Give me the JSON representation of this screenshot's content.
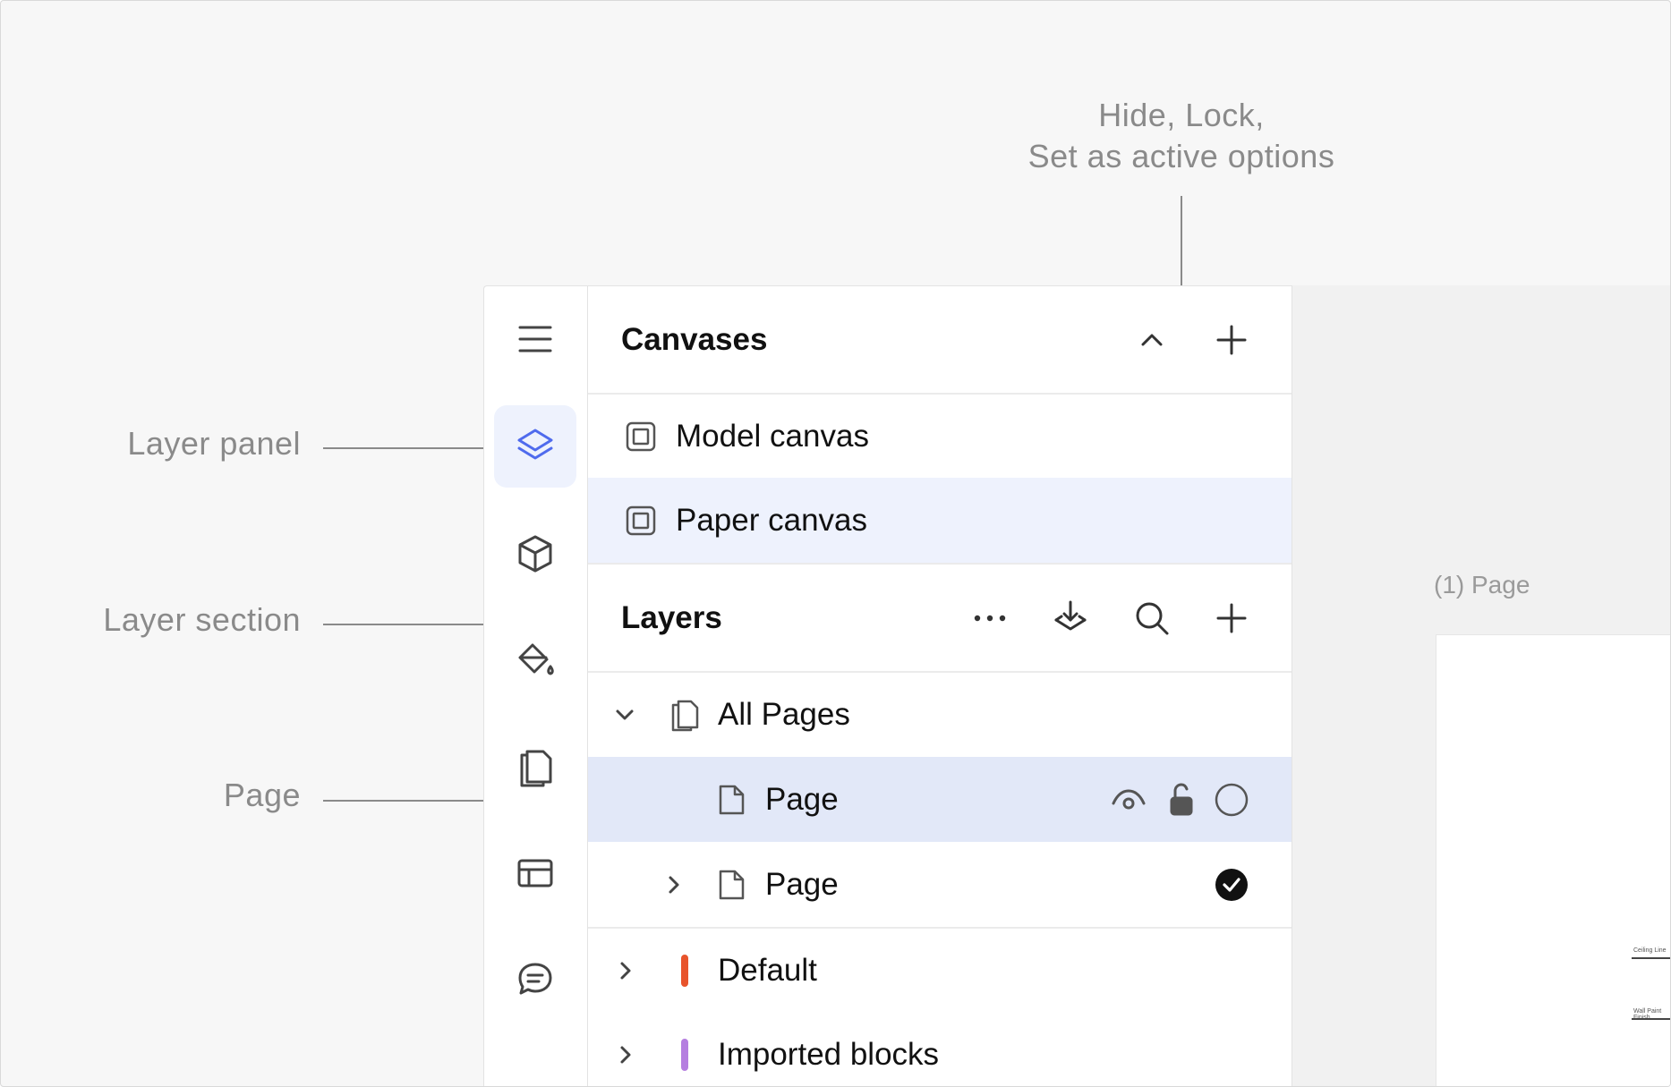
{
  "annotations": {
    "hide_lock": "Hide, Lock,",
    "set_active": "Set as active options",
    "layer_panel": "Layer panel",
    "layer_section": "Layer section",
    "page": "Page"
  },
  "rail": {
    "items": [
      {
        "icon": "menu-icon",
        "active": false
      },
      {
        "icon": "layers-icon",
        "active": true
      },
      {
        "icon": "cube-icon",
        "active": false
      },
      {
        "icon": "paint-bucket-icon",
        "active": false
      },
      {
        "icon": "pages-icon",
        "active": false
      },
      {
        "icon": "table-icon",
        "active": false
      },
      {
        "icon": "comment-icon",
        "active": false
      }
    ]
  },
  "canvases": {
    "title": "Canvases",
    "items": [
      {
        "label": "Model canvas",
        "selected": false
      },
      {
        "label": "Paper canvas",
        "selected": true
      }
    ]
  },
  "layers": {
    "title": "Layers",
    "tree": {
      "all_pages": "All Pages",
      "pages": [
        {
          "label": "Page",
          "selected": true,
          "expandable": false
        },
        {
          "label": "Page",
          "selected": false,
          "expandable": true,
          "active": true
        }
      ],
      "groups": [
        {
          "label": "Default",
          "color": "#e8542c"
        },
        {
          "label": "Imported blocks",
          "color": "#b57ee0"
        }
      ]
    }
  },
  "preview": {
    "caption": "(1) Page",
    "mini_labels": [
      "Ceiling Line",
      "Wall Paint Finish"
    ]
  },
  "colors": {
    "accent": "#4f6bed",
    "selection_light": "#eef2fd",
    "selection_strong": "#e2e8f8"
  }
}
